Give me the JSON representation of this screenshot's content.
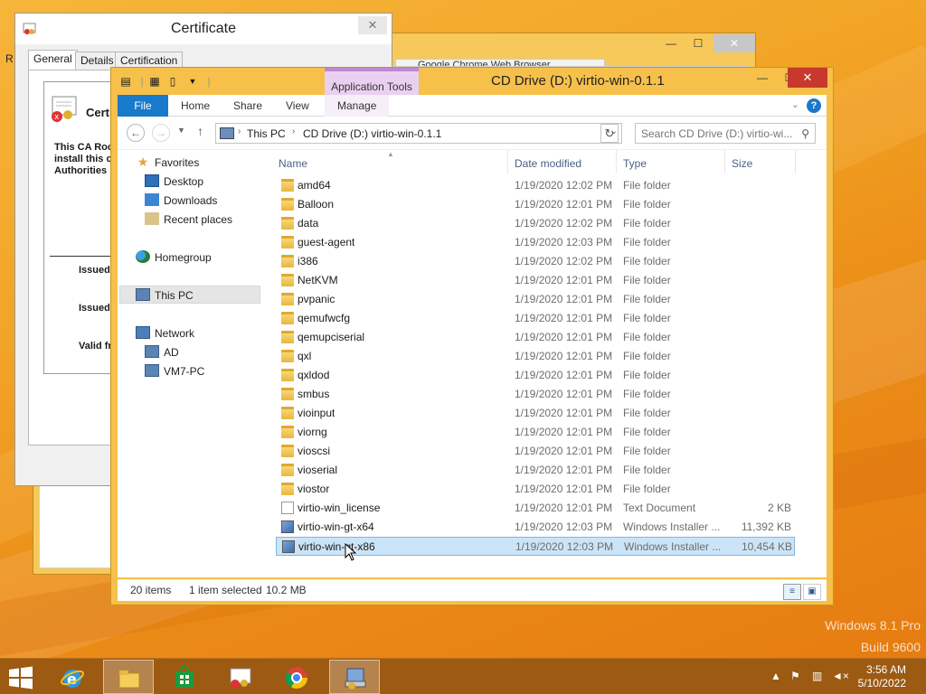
{
  "desktop": {
    "watermark_line1": "Windows 8.1 Pro",
    "watermark_line2": "Build 9600",
    "edge_letter": "R"
  },
  "certificate": {
    "title": "Certificate",
    "close_glyph": "✕",
    "tabs": [
      "General",
      "Details",
      "Certification Path"
    ],
    "heading": "Certi",
    "body_line1": "This CA Roo",
    "body_line2": "install this c",
    "body_line3": "Authorities",
    "issued_to": "Issued",
    "issued_by": "Issued",
    "valid_from": "Valid fr"
  },
  "background_window": {
    "tab_title": "Google Chrome Web Browser",
    "min_glyph": "—",
    "max_glyph": "☐",
    "close_glyph": "✕"
  },
  "explorer": {
    "title": "CD Drive (D:) virtio-win-0.1.1",
    "app_tools": "Application Tools",
    "min_glyph": "—",
    "max_glyph": "☐",
    "close_glyph": "✕",
    "ribbon_tabs": [
      "File",
      "Home",
      "Share",
      "View",
      "Manage"
    ],
    "address": {
      "crumbs": [
        "This PC",
        "CD Drive (D:) virtio-win-0.1.1"
      ]
    },
    "search_placeholder": "Search CD Drive (D:) virtio-wi...",
    "nav": {
      "favorites": "Favorites",
      "desktop": "Desktop",
      "downloads": "Downloads",
      "recent": "Recent places",
      "homegroup": "Homegroup",
      "this_pc": "This PC",
      "network": "Network",
      "ad": "AD",
      "vm7": "VM7-PC"
    },
    "columns": {
      "name": "Name",
      "date": "Date modified",
      "type": "Type",
      "size": "Size"
    },
    "files": [
      {
        "name": "amd64",
        "date": "1/19/2020 12:02 PM",
        "type": "File folder",
        "size": "",
        "icon": "folder"
      },
      {
        "name": "Balloon",
        "date": "1/19/2020 12:01 PM",
        "type": "File folder",
        "size": "",
        "icon": "folder"
      },
      {
        "name": "data",
        "date": "1/19/2020 12:02 PM",
        "type": "File folder",
        "size": "",
        "icon": "folder"
      },
      {
        "name": "guest-agent",
        "date": "1/19/2020 12:03 PM",
        "type": "File folder",
        "size": "",
        "icon": "folder"
      },
      {
        "name": "i386",
        "date": "1/19/2020 12:02 PM",
        "type": "File folder",
        "size": "",
        "icon": "folder"
      },
      {
        "name": "NetKVM",
        "date": "1/19/2020 12:01 PM",
        "type": "File folder",
        "size": "",
        "icon": "folder"
      },
      {
        "name": "pvpanic",
        "date": "1/19/2020 12:01 PM",
        "type": "File folder",
        "size": "",
        "icon": "folder"
      },
      {
        "name": "qemufwcfg",
        "date": "1/19/2020 12:01 PM",
        "type": "File folder",
        "size": "",
        "icon": "folder"
      },
      {
        "name": "qemupciserial",
        "date": "1/19/2020 12:01 PM",
        "type": "File folder",
        "size": "",
        "icon": "folder"
      },
      {
        "name": "qxl",
        "date": "1/19/2020 12:01 PM",
        "type": "File folder",
        "size": "",
        "icon": "folder"
      },
      {
        "name": "qxldod",
        "date": "1/19/2020 12:01 PM",
        "type": "File folder",
        "size": "",
        "icon": "folder"
      },
      {
        "name": "smbus",
        "date": "1/19/2020 12:01 PM",
        "type": "File folder",
        "size": "",
        "icon": "folder"
      },
      {
        "name": "vioinput",
        "date": "1/19/2020 12:01 PM",
        "type": "File folder",
        "size": "",
        "icon": "folder"
      },
      {
        "name": "viorng",
        "date": "1/19/2020 12:01 PM",
        "type": "File folder",
        "size": "",
        "icon": "folder"
      },
      {
        "name": "vioscsi",
        "date": "1/19/2020 12:01 PM",
        "type": "File folder",
        "size": "",
        "icon": "folder"
      },
      {
        "name": "vioserial",
        "date": "1/19/2020 12:01 PM",
        "type": "File folder",
        "size": "",
        "icon": "folder"
      },
      {
        "name": "viostor",
        "date": "1/19/2020 12:01 PM",
        "type": "File folder",
        "size": "",
        "icon": "folder"
      },
      {
        "name": "virtio-win_license",
        "date": "1/19/2020 12:01 PM",
        "type": "Text Document",
        "size": "2 KB",
        "icon": "text"
      },
      {
        "name": "virtio-win-gt-x64",
        "date": "1/19/2020 12:03 PM",
        "type": "Windows Installer ...",
        "size": "11,392 KB",
        "icon": "msi"
      },
      {
        "name": "virtio-win-gt-x86",
        "date": "1/19/2020 12:03 PM",
        "type": "Windows Installer ...",
        "size": "10,454 KB",
        "icon": "msi",
        "selected": true
      }
    ],
    "status": {
      "count": "20 items",
      "selection": "1 item selected",
      "size": "10.2 MB"
    }
  },
  "taskbar": {
    "time": "3:56 AM",
    "date": "5/10/2022",
    "apps": [
      "internet-explorer",
      "file-explorer",
      "store",
      "certificate",
      "chrome",
      "installer"
    ],
    "tray_icons": [
      "show-hidden-icons",
      "flag-icon",
      "network-icon",
      "volume-muted-icon"
    ]
  },
  "colors": {
    "accent": "#1979ca",
    "selection": "#cce4f7",
    "window_frame": "#f6c04a",
    "close_button": "#c7392c",
    "taskbar": "#9c5a12"
  }
}
